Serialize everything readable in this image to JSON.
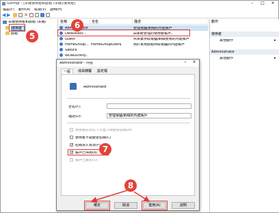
{
  "window": {
    "title": "lusrmgr - [本機使用者和群組 (本機)\\使用者]",
    "controls": [
      "–",
      "□",
      "×"
    ],
    "menu": [
      "檔案(F)",
      "動作(A)",
      "檢視(V)",
      "說明(H)"
    ]
  },
  "tree": {
    "root": "本機使用者和群組 (本機)",
    "items": [
      "使用者",
      "群組"
    ]
  },
  "list": {
    "columns": [
      "名稱",
      "全名",
      "描述"
    ],
    "rows": [
      {
        "name": "Administrator",
        "full": "",
        "desc": "管理電腦/網域的內建帳戶"
      },
      {
        "name": "DefaultAcc...",
        "full": "",
        "desc": "由系統管理的使用者帳戶。"
      },
      {
        "name": "Guest",
        "full": "",
        "desc": "供來賓存取電腦/網域使用的內建帳戶"
      },
      {
        "name": "HomeGroup...",
        "full": "HomeGroupUser$",
        "desc": "用於家用群組存取電腦的內建帳戶"
      },
      {
        "name": "Sakura",
        "full": "",
        "desc": ""
      },
      {
        "name": "WDAGUtility...",
        "full": "",
        "desc": ""
      }
    ]
  },
  "actions": {
    "sections": [
      {
        "header": "使用者",
        "items": [
          "其他動作"
        ]
      },
      {
        "header": "Administrator",
        "items": [
          "其他動作"
        ]
      }
    ]
  },
  "dialog": {
    "title": "Administrator - 內容",
    "close": "×",
    "help": "?",
    "tabs": [
      "一般",
      "成員隸屬",
      "設定檔"
    ],
    "username": "Administrator",
    "full_name_label": "全名(F):",
    "full_name_value": "",
    "desc_label": "描述(D):",
    "desc_value": "管理電腦/網域的內建帳戶",
    "checkboxes": [
      {
        "label": "使用者必須在下次登入時變更密碼(M)",
        "checked": false,
        "enabled": false
      },
      {
        "label": "使用者不能變更密碼(C)",
        "checked": false,
        "enabled": true
      },
      {
        "label": "密碼永久有效(P)",
        "checked": true,
        "enabled": true
      },
      {
        "label": "帳戶已停用(B)",
        "checked": true,
        "enabled": true
      },
      {
        "label": "帳戶已鎖定(O)",
        "checked": false,
        "enabled": false
      }
    ],
    "buttons": {
      "ok": "確定",
      "cancel": "取消",
      "apply": "套用(A)",
      "help": "說明"
    }
  },
  "annotations": {
    "b5": "5",
    "b6": "6",
    "b7": "7",
    "b8": "8"
  },
  "colors": {
    "annotation": "#e2433a",
    "selection": "#cce4f7",
    "tree_selected": "#0078d7"
  }
}
